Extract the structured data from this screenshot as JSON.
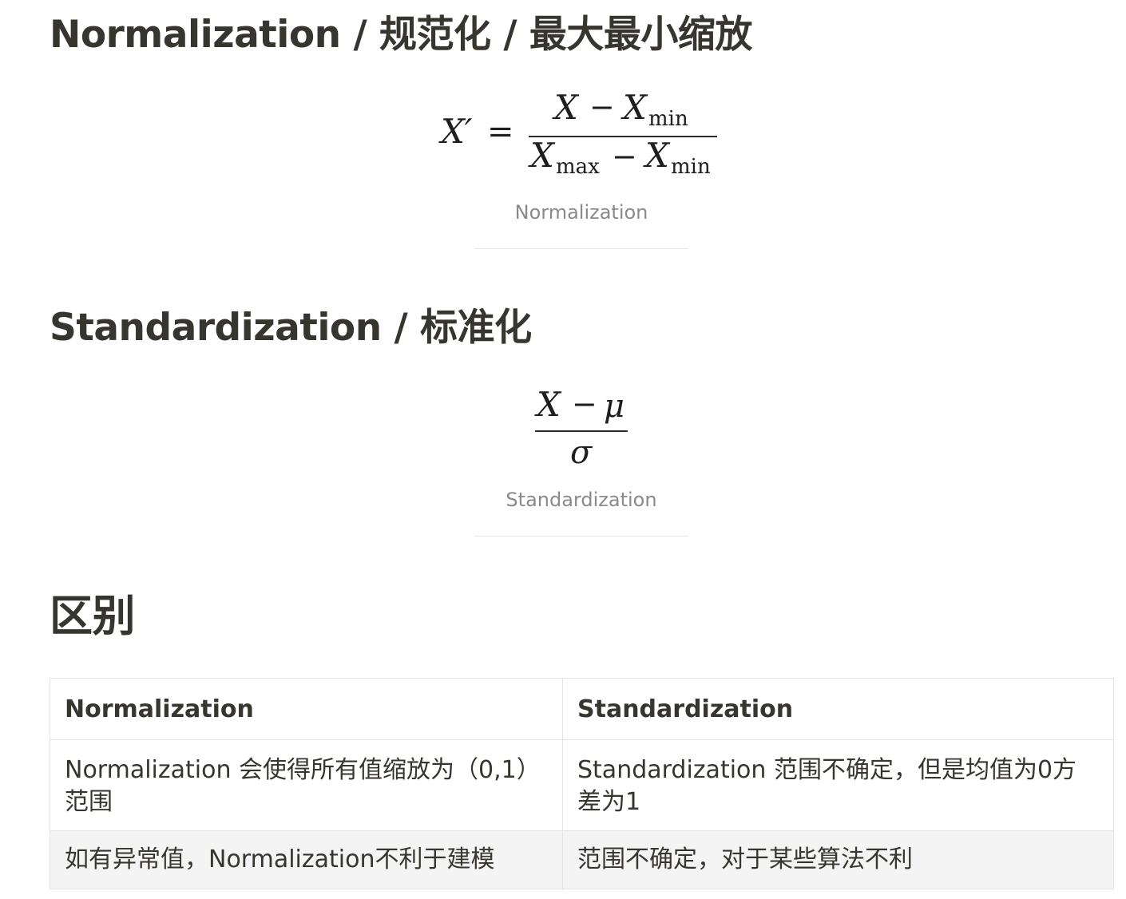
{
  "normalization_section": {
    "heading": "Normalization / 规范化 / 最大最小缩放",
    "formula": {
      "lhs": "X′",
      "equals": "=",
      "numerator_x": "X",
      "numerator_minus": "−",
      "numerator_x2": "X",
      "numerator_sub": "min",
      "denominator_x": "X",
      "denominator_sub1": "max",
      "denominator_minus": "−",
      "denominator_x2": "X",
      "denominator_sub2": "min"
    },
    "caption": "Normalization"
  },
  "standardization_section": {
    "heading": "Standardization / 标准化",
    "formula": {
      "numerator_x": "X",
      "numerator_minus": "−",
      "numerator_mu": "μ",
      "denominator_sigma": "σ"
    },
    "caption": "Standardization"
  },
  "difference_section": {
    "heading": "区别",
    "table": {
      "headers": [
        "Normalization",
        "Standardization"
      ],
      "rows": [
        [
          "Normalization 会使得所有值缩放为（0,1）范围",
          "Standardization 范围不确定，但是均值为0方差为1"
        ],
        [
          "如有异常值，Normalization不利于建模",
          "范围不确定，对于某些算法不利"
        ]
      ]
    }
  }
}
